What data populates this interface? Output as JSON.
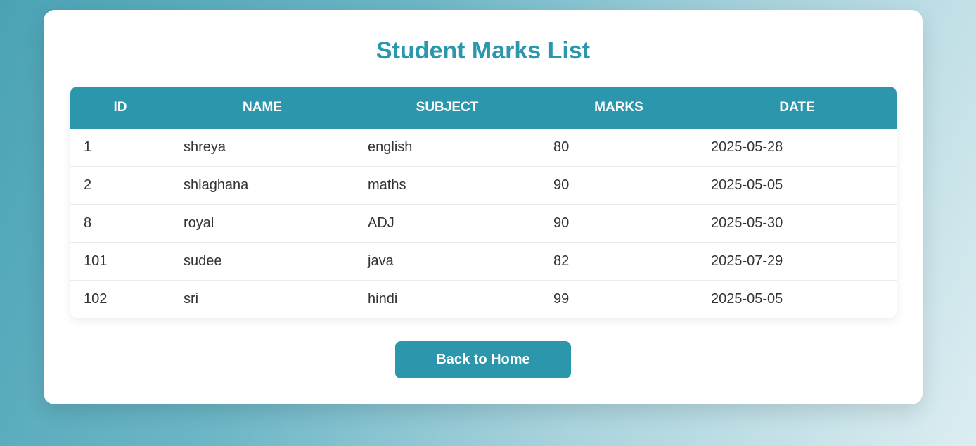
{
  "page": {
    "title": "Student Marks List"
  },
  "table": {
    "headers": {
      "id": "ID",
      "name": "NAME",
      "subject": "SUBJECT",
      "marks": "MARKS",
      "date": "DATE"
    },
    "rows": [
      {
        "id": "1",
        "name": "shreya",
        "subject": "english",
        "marks": "80",
        "date": "2025-05-28"
      },
      {
        "id": "2",
        "name": "shlaghana",
        "subject": "maths",
        "marks": "90",
        "date": "2025-05-05"
      },
      {
        "id": "8",
        "name": "royal",
        "subject": "ADJ",
        "marks": "90",
        "date": "2025-05-30"
      },
      {
        "id": "101",
        "name": "sudee",
        "subject": "java",
        "marks": "82",
        "date": "2025-07-29"
      },
      {
        "id": "102",
        "name": "sri",
        "subject": "hindi",
        "marks": "99",
        "date": "2025-05-05"
      }
    ]
  },
  "actions": {
    "back_label": "Back to Home"
  },
  "colors": {
    "accent": "#2c97ac",
    "background_start": "#4aa3b5",
    "background_end": "#dcedf1"
  }
}
